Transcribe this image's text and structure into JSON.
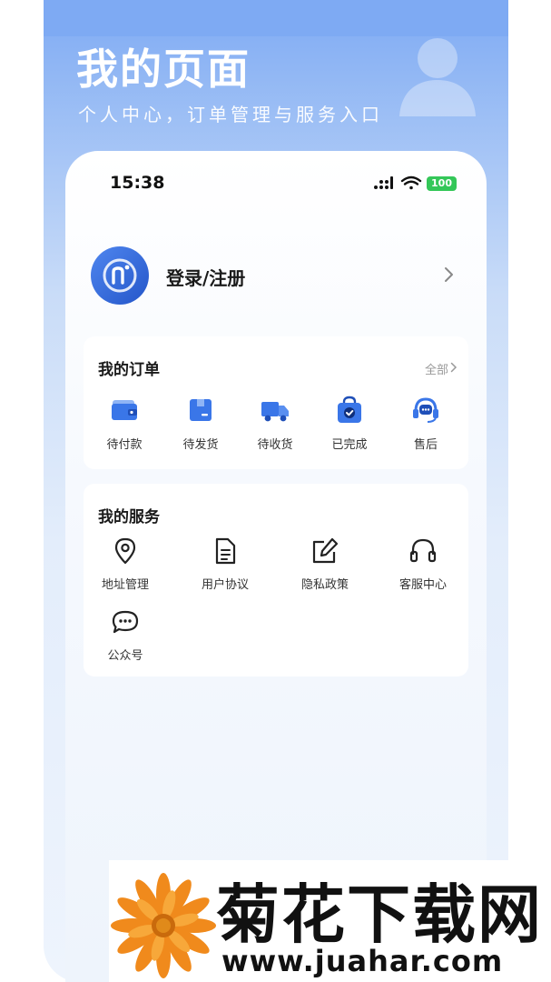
{
  "header": {
    "title": "我的页面",
    "subtitle": "个人中心，订单管理与服务入口"
  },
  "status_bar": {
    "time": "15:38",
    "battery": "100",
    "battery_color": "#34c759"
  },
  "login": {
    "label": "登录/注册",
    "avatar_icon": "app-logo-icon"
  },
  "orders": {
    "title": "我的订单",
    "more_label": "全部",
    "items": [
      {
        "label": "待付款",
        "icon": "wallet-icon"
      },
      {
        "label": "待发货",
        "icon": "package-icon"
      },
      {
        "label": "待收货",
        "icon": "truck-icon"
      },
      {
        "label": "已完成",
        "icon": "bag-check-icon"
      },
      {
        "label": "售后",
        "icon": "headset-chat-icon"
      }
    ]
  },
  "services": {
    "title": "我的服务",
    "items": [
      {
        "label": "地址管理",
        "icon": "location-pin-icon"
      },
      {
        "label": "用户协议",
        "icon": "document-icon"
      },
      {
        "label": "隐私政策",
        "icon": "edit-icon"
      },
      {
        "label": "客服中心",
        "icon": "headphones-icon"
      },
      {
        "label": "公众号",
        "icon": "chat-bubbles-icon"
      }
    ]
  },
  "watermark": {
    "text": "菊花下载网",
    "url": "www.juahar.com"
  },
  "colors": {
    "accent": "#3a76e8",
    "header_gradient_top": "#7eaaf3"
  }
}
